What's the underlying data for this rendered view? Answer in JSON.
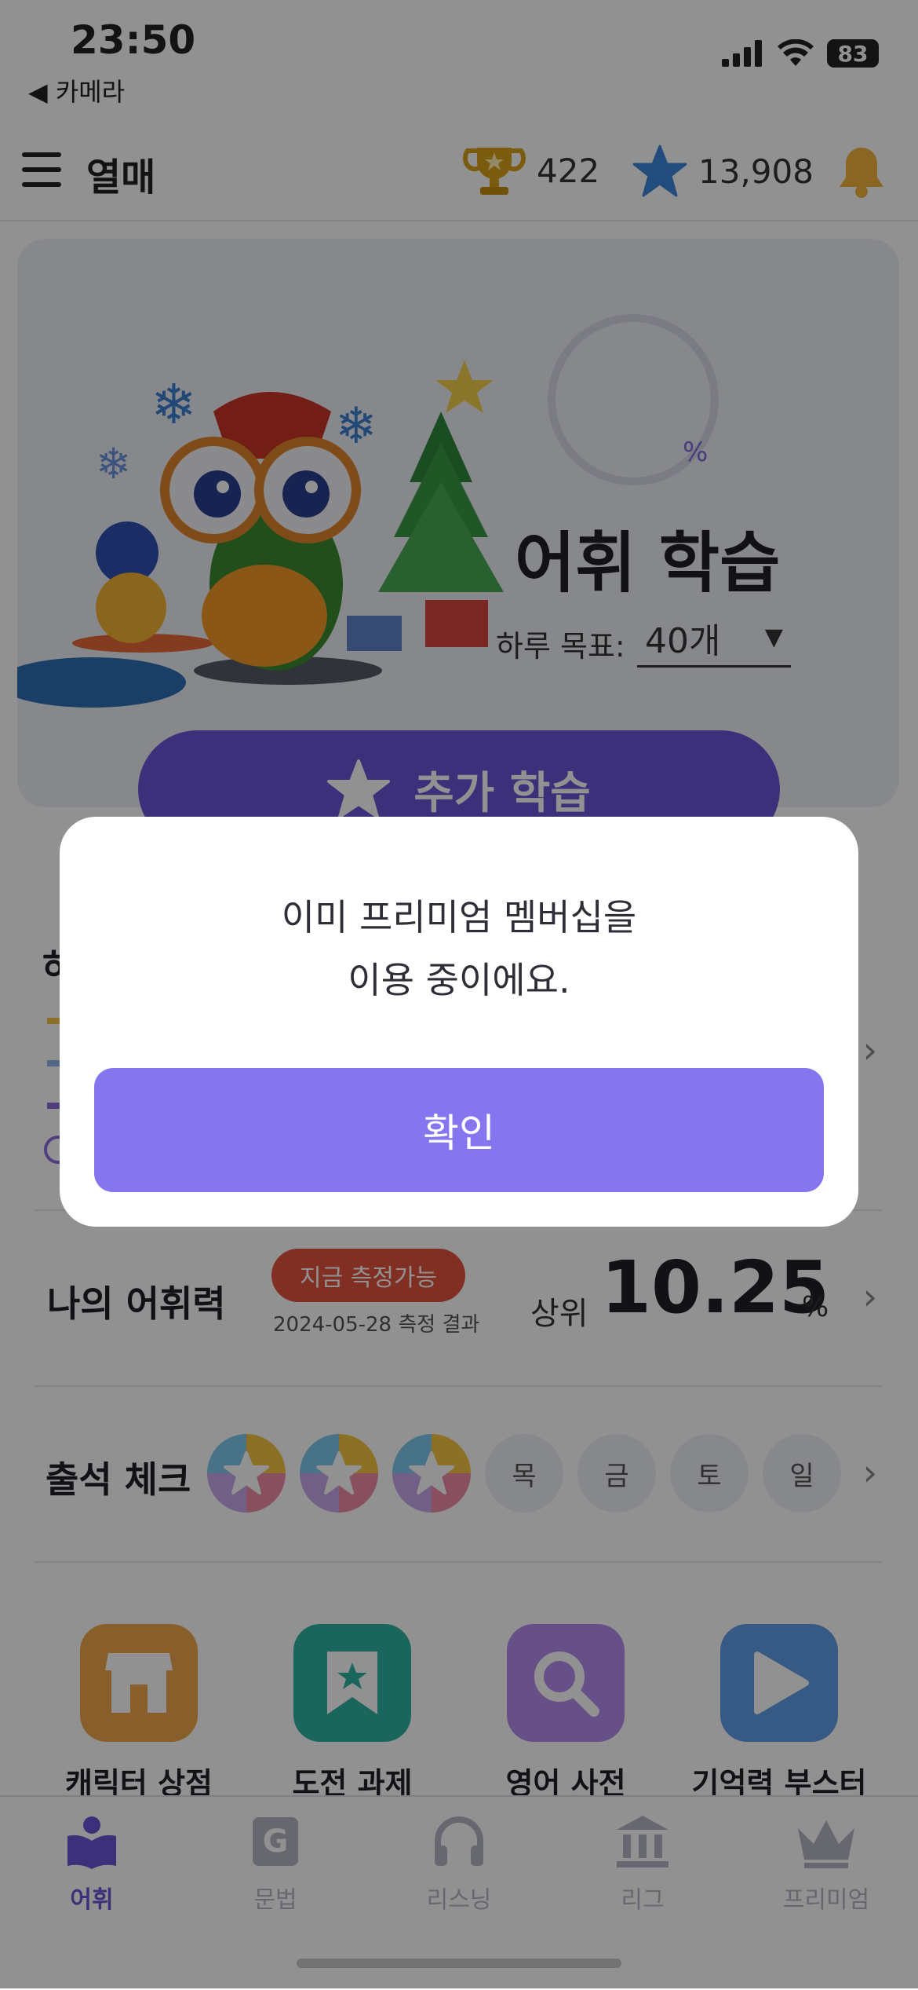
{
  "status_bar": {
    "time": "23:50",
    "back_app": "◀ 카메라",
    "battery": "83"
  },
  "header": {
    "nickname": "열매",
    "trophy_count": "422",
    "star_count": "13,908"
  },
  "vocab_card": {
    "progress_unit": "%",
    "title": "어휘 학습",
    "goal_label": "하루 목표:",
    "goal_value": "40개",
    "extra_study_label": "추가 학습"
  },
  "partial_section": {
    "title_fragment": "하"
  },
  "vocab_level": {
    "title": "나의 어휘력",
    "badge": "지금 측정가능",
    "date": "2024-05-28 측정 결과",
    "rank_label": "상위",
    "rank_value": "10.25",
    "rank_unit": "%"
  },
  "attendance": {
    "title": "출석 체크",
    "checked_days": 3,
    "remaining_days": [
      "목",
      "금",
      "토",
      "일"
    ]
  },
  "shortcuts": [
    {
      "label": "캐릭터 상점",
      "icon": "shop-icon",
      "color": "#f0a84a"
    },
    {
      "label": "도전 과제",
      "icon": "bookmark-star-icon",
      "color": "#2fb3a2"
    },
    {
      "label": "영어 사전",
      "icon": "magnifier-icon",
      "color": "#b58cee"
    },
    {
      "label": "기억력 부스터",
      "icon": "play-icon",
      "color": "#5f9fe8"
    }
  ],
  "tabs": [
    {
      "label": "어휘",
      "icon": "book-icon",
      "active": true
    },
    {
      "label": "문법",
      "icon": "grammar-book-icon",
      "active": false
    },
    {
      "label": "리스닝",
      "icon": "headphones-icon",
      "active": false
    },
    {
      "label": "리그",
      "icon": "league-building-icon",
      "active": false
    },
    {
      "label": "프리미엄",
      "icon": "crown-icon",
      "active": false
    }
  ],
  "dialog": {
    "message_line1": "이미 프리미엄 멤버십을",
    "message_line2": "이용 중이에요.",
    "confirm_label": "확인"
  },
  "colors": {
    "accent": "#6b55d8",
    "dialog_button": "#8576f0",
    "badge_red": "#e1533d",
    "overlay": "rgba(0,0,0,0.43)"
  }
}
